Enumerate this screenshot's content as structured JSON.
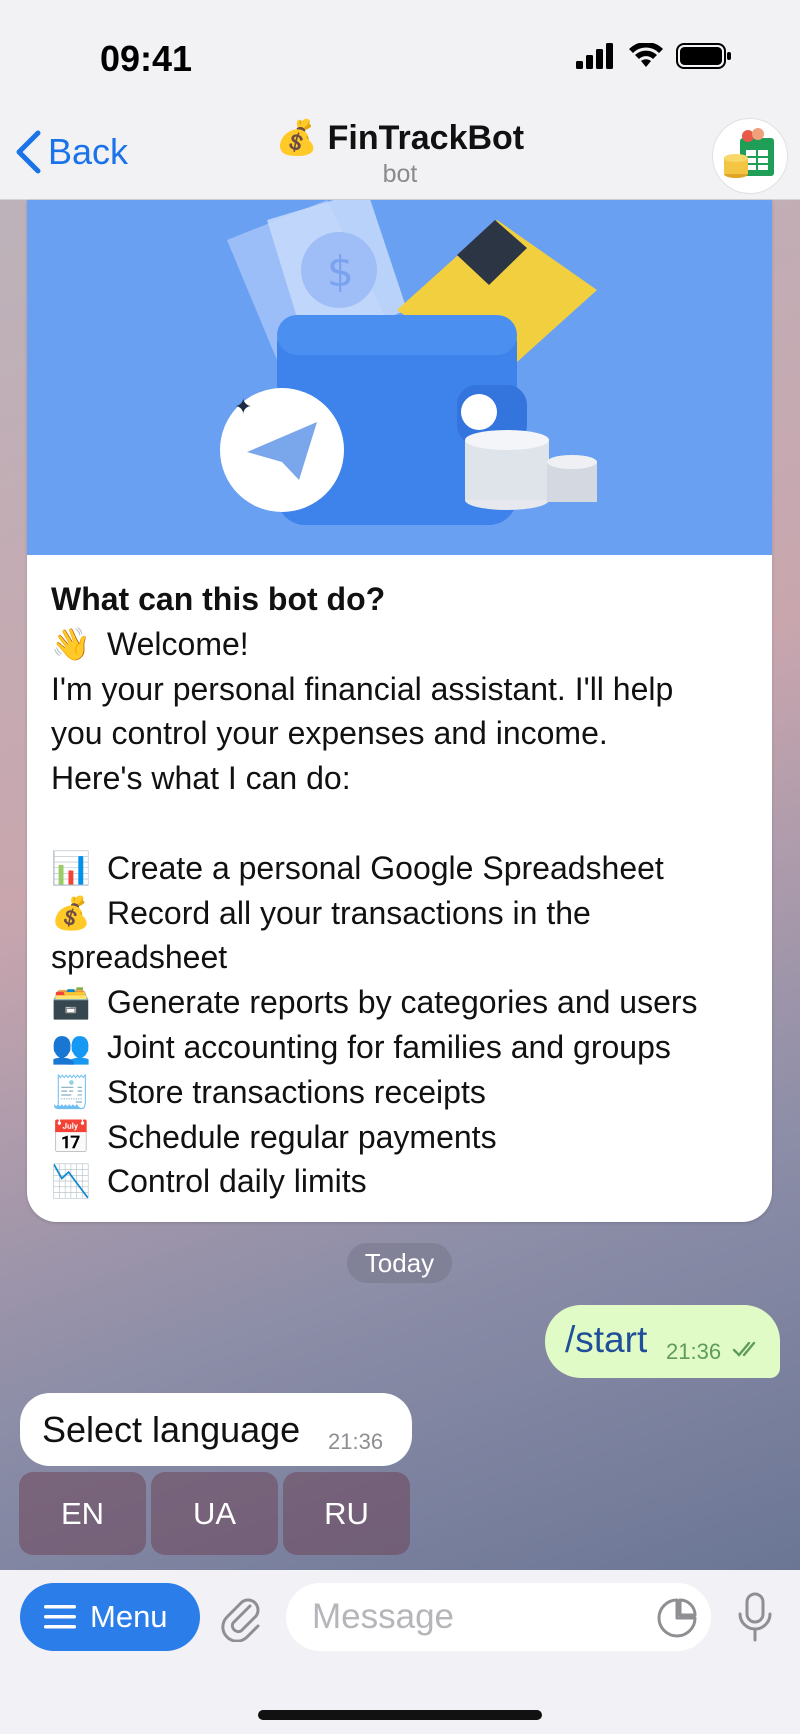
{
  "status": {
    "time": "09:41"
  },
  "header": {
    "back_label": "Back",
    "title": "💰 FinTrackBot",
    "subtitle": "bot"
  },
  "welcome": {
    "title": "What can this bot do?",
    "greeting_emoji": "👋",
    "greeting": "Welcome!",
    "intro_lines": [
      "I'm your personal financial assistant. I'll help",
      "you control your expenses and income.",
      "Here's what I can do:"
    ],
    "features": [
      {
        "emoji": "📊",
        "text": "Create a personal Google Spreadsheet"
      },
      {
        "emoji": "💰",
        "text": "Record all your transactions in the",
        "cont": "spreadsheet"
      },
      {
        "emoji": "🗃️",
        "text": "Generate reports by categories and users"
      },
      {
        "emoji": "👥",
        "text": "Joint accounting for families and groups"
      },
      {
        "emoji": "🧾",
        "text": "Store transactions receipts"
      },
      {
        "emoji": "📅",
        "text": "Schedule regular payments"
      },
      {
        "emoji": "📉",
        "text": "Control daily limits"
      }
    ]
  },
  "chat": {
    "date_label": "Today",
    "outgoing": {
      "text": "/start",
      "time": "21:36"
    },
    "incoming": {
      "text": "Select language",
      "time": "21:36"
    },
    "keyboard": [
      "EN",
      "UA",
      "RU"
    ]
  },
  "input": {
    "menu_label": "Menu",
    "placeholder": "Message"
  },
  "colors": {
    "accent": "#2b7de9",
    "outgoing_bubble": "#e1fbc7",
    "hero_bg": "#6aa0f2"
  }
}
